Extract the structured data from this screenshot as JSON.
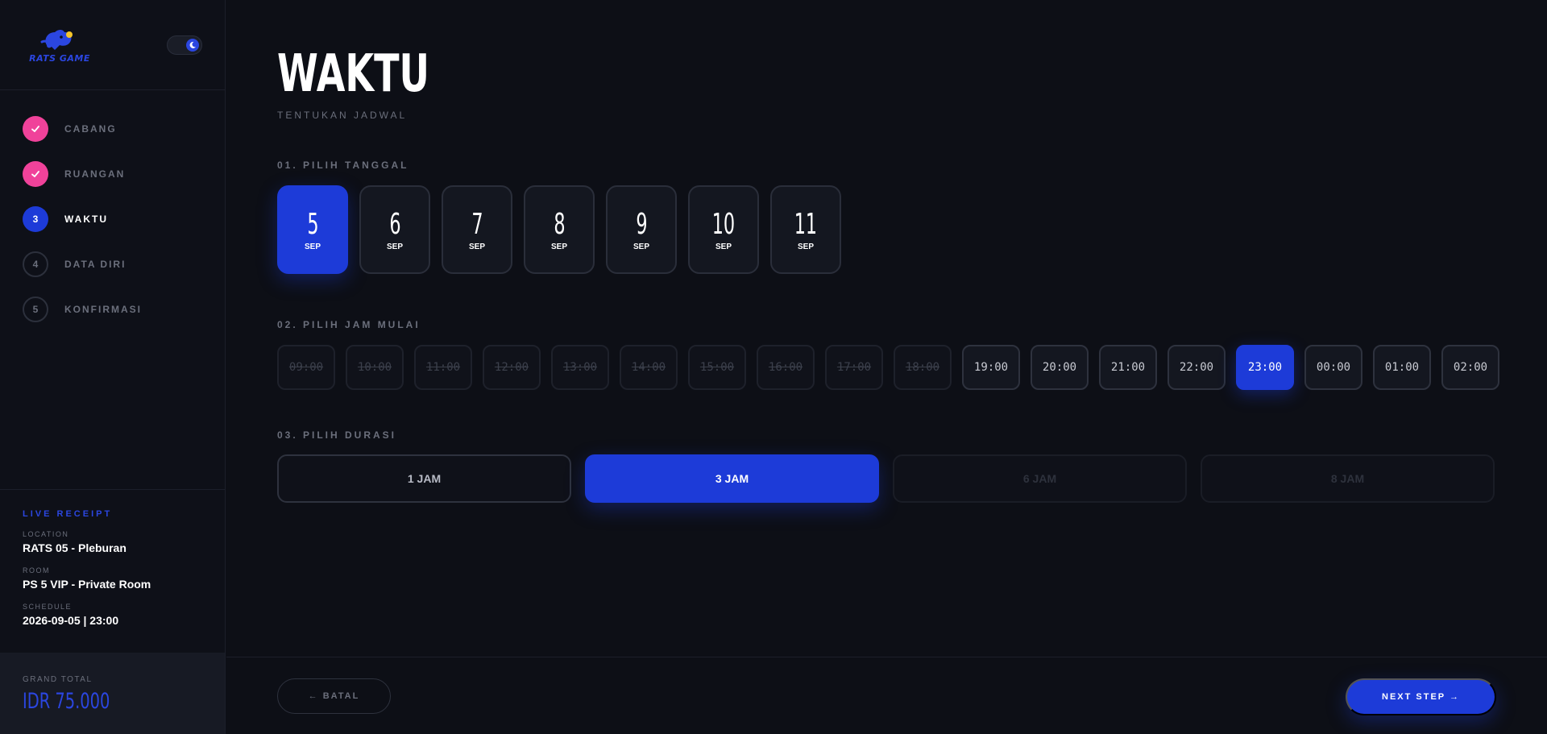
{
  "brand": {
    "logo_text": "RATS GAME",
    "accent": "#1d3bd8",
    "done_color": "#f0429a"
  },
  "theme_toggle": {
    "icon": "moon-icon"
  },
  "steps": [
    {
      "number": "1",
      "label": "CABANG",
      "state": "done"
    },
    {
      "number": "2",
      "label": "RUANGAN",
      "state": "done"
    },
    {
      "number": "3",
      "label": "WAKTU",
      "state": "active"
    },
    {
      "number": "4",
      "label": "DATA DIRI",
      "state": "pending"
    },
    {
      "number": "5",
      "label": "KONFIRMASI",
      "state": "pending"
    }
  ],
  "receipt": {
    "title": "LIVE RECEIPT",
    "location_label": "LOCATION",
    "location": "RATS 05 - Pleburan",
    "room_label": "ROOM",
    "room": "PS 5 VIP - Private Room",
    "schedule_label": "SCHEDULE",
    "schedule": "2026-09-05 | 23:00"
  },
  "grand_total": {
    "label": "GRAND TOTAL",
    "value": "IDR 75.000"
  },
  "page": {
    "title": "WAKTU",
    "subtitle": "TENTUKAN JADWAL"
  },
  "sections": {
    "date": "01. PILIH TANGGAL",
    "time": "02. PILIH JAM MULAI",
    "duration": "03. PILIH DURASI"
  },
  "dates": [
    {
      "day": "5",
      "month": "SEP",
      "selected": true
    },
    {
      "day": "6",
      "month": "SEP",
      "selected": false
    },
    {
      "day": "7",
      "month": "SEP",
      "selected": false
    },
    {
      "day": "8",
      "month": "SEP",
      "selected": false
    },
    {
      "day": "9",
      "month": "SEP",
      "selected": false
    },
    {
      "day": "10",
      "month": "SEP",
      "selected": false
    },
    {
      "day": "11",
      "month": "SEP",
      "selected": false
    }
  ],
  "times": [
    {
      "label": "09:00",
      "state": "disabled"
    },
    {
      "label": "10:00",
      "state": "disabled"
    },
    {
      "label": "11:00",
      "state": "disabled"
    },
    {
      "label": "12:00",
      "state": "disabled"
    },
    {
      "label": "13:00",
      "state": "disabled"
    },
    {
      "label": "14:00",
      "state": "disabled"
    },
    {
      "label": "15:00",
      "state": "disabled"
    },
    {
      "label": "16:00",
      "state": "disabled"
    },
    {
      "label": "17:00",
      "state": "disabled"
    },
    {
      "label": "18:00",
      "state": "disabled"
    },
    {
      "label": "19:00",
      "state": "available"
    },
    {
      "label": "20:00",
      "state": "available"
    },
    {
      "label": "21:00",
      "state": "available"
    },
    {
      "label": "22:00",
      "state": "available"
    },
    {
      "label": "23:00",
      "state": "selected"
    },
    {
      "label": "00:00",
      "state": "available"
    },
    {
      "label": "01:00",
      "state": "available"
    },
    {
      "label": "02:00",
      "state": "available"
    }
  ],
  "durations": [
    {
      "label": "1 JAM",
      "state": "available"
    },
    {
      "label": "3 JAM",
      "state": "selected"
    },
    {
      "label": "6 JAM",
      "state": "disabled"
    },
    {
      "label": "8 JAM",
      "state": "disabled"
    }
  ],
  "footer": {
    "back_label": "← BATAL",
    "next_label": "NEXT STEP →"
  }
}
